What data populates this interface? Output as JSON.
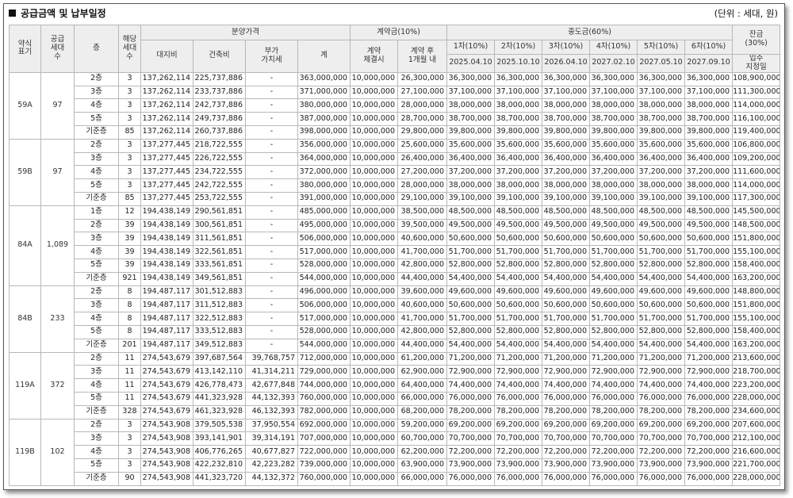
{
  "header": {
    "title": "공급금액 및 납부일정",
    "unit": "(단위 : 세대, 원)"
  },
  "columns": {
    "type": "약식\n표기",
    "households": "공급\n세대\n수",
    "floor": "층",
    "count": "해당\n세대\n수",
    "price_group": "분양가격",
    "land": "대지비",
    "building": "건축비",
    "vat": "부가\n가치세",
    "total": "계",
    "deposit_group": "계약금(10%)",
    "dep1": "계약\n체결시",
    "dep2": "계약 후\n1개월 내",
    "mid_group": "중도금(60%)",
    "mids": [
      {
        "label": "1차(10%)",
        "date": "2025.04.10"
      },
      {
        "label": "2차(10%)",
        "date": "2025.10.10"
      },
      {
        "label": "3차(10%)",
        "date": "2026.04.10"
      },
      {
        "label": "4차(10%)",
        "date": "2027.02.10"
      },
      {
        "label": "5차(10%)",
        "date": "2027.05.10"
      },
      {
        "label": "6차(10%)",
        "date": "2027.09.10"
      }
    ],
    "balance": "잔금\n(30%)",
    "balance_date": "입주\n지정일"
  },
  "groups": [
    {
      "type": "59A",
      "households": "97",
      "rows": [
        [
          "2층",
          "3",
          "137,262,114",
          "225,737,886",
          "-",
          "363,000,000",
          "10,000,000",
          "26,300,000",
          "36,300,000",
          "36,300,000",
          "36,300,000",
          "36,300,000",
          "36,300,000",
          "36,300,000",
          "108,900,000"
        ],
        [
          "3층",
          "3",
          "137,262,114",
          "233,737,886",
          "-",
          "371,000,000",
          "10,000,000",
          "27,100,000",
          "37,100,000",
          "37,100,000",
          "37,100,000",
          "37,100,000",
          "37,100,000",
          "37,100,000",
          "111,300,000"
        ],
        [
          "4층",
          "3",
          "137,262,114",
          "242,737,886",
          "-",
          "380,000,000",
          "10,000,000",
          "28,000,000",
          "38,000,000",
          "38,000,000",
          "38,000,000",
          "38,000,000",
          "38,000,000",
          "38,000,000",
          "114,000,000"
        ],
        [
          "5층",
          "3",
          "137,262,114",
          "249,737,886",
          "-",
          "387,000,000",
          "10,000,000",
          "28,700,000",
          "38,700,000",
          "38,700,000",
          "38,700,000",
          "38,700,000",
          "38,700,000",
          "38,700,000",
          "116,100,000"
        ],
        [
          "기준층",
          "85",
          "137,262,114",
          "260,737,886",
          "-",
          "398,000,000",
          "10,000,000",
          "29,800,000",
          "39,800,000",
          "39,800,000",
          "39,800,000",
          "39,800,000",
          "39,800,000",
          "39,800,000",
          "119,400,000"
        ]
      ]
    },
    {
      "type": "59B",
      "households": "97",
      "rows": [
        [
          "2층",
          "3",
          "137,277,445",
          "218,722,555",
          "-",
          "356,000,000",
          "10,000,000",
          "25,600,000",
          "35,600,000",
          "35,600,000",
          "35,600,000",
          "35,600,000",
          "35,600,000",
          "35,600,000",
          "106,800,000"
        ],
        [
          "3층",
          "3",
          "137,277,445",
          "226,722,555",
          "-",
          "364,000,000",
          "10,000,000",
          "26,400,000",
          "36,400,000",
          "36,400,000",
          "36,400,000",
          "36,400,000",
          "36,400,000",
          "36,400,000",
          "109,200,000"
        ],
        [
          "4층",
          "3",
          "137,277,445",
          "234,722,555",
          "-",
          "372,000,000",
          "10,000,000",
          "27,200,000",
          "37,200,000",
          "37,200,000",
          "37,200,000",
          "37,200,000",
          "37,200,000",
          "37,200,000",
          "111,600,000"
        ],
        [
          "5층",
          "3",
          "137,277,445",
          "242,722,555",
          "-",
          "380,000,000",
          "10,000,000",
          "28,000,000",
          "38,000,000",
          "38,000,000",
          "38,000,000",
          "38,000,000",
          "38,000,000",
          "38,000,000",
          "114,000,000"
        ],
        [
          "기준층",
          "85",
          "137,277,445",
          "253,722,555",
          "-",
          "391,000,000",
          "10,000,000",
          "29,100,000",
          "39,100,000",
          "39,100,000",
          "39,100,000",
          "39,100,000",
          "39,100,000",
          "39,100,000",
          "117,300,000"
        ]
      ]
    },
    {
      "type": "84A",
      "households": "1,089",
      "rows": [
        [
          "1층",
          "12",
          "194,438,149",
          "290,561,851",
          "-",
          "485,000,000",
          "10,000,000",
          "38,500,000",
          "48,500,000",
          "48,500,000",
          "48,500,000",
          "48,500,000",
          "48,500,000",
          "48,500,000",
          "145,500,000"
        ],
        [
          "2층",
          "39",
          "194,438,149",
          "300,561,851",
          "-",
          "495,000,000",
          "10,000,000",
          "39,500,000",
          "49,500,000",
          "49,500,000",
          "49,500,000",
          "49,500,000",
          "49,500,000",
          "49,500,000",
          "148,500,000"
        ],
        [
          "3층",
          "39",
          "194,438,149",
          "311,561,851",
          "-",
          "506,000,000",
          "10,000,000",
          "40,600,000",
          "50,600,000",
          "50,600,000",
          "50,600,000",
          "50,600,000",
          "50,600,000",
          "50,600,000",
          "151,800,000"
        ],
        [
          "4층",
          "39",
          "194,438,149",
          "322,561,851",
          "-",
          "517,000,000",
          "10,000,000",
          "41,700,000",
          "51,700,000",
          "51,700,000",
          "51,700,000",
          "51,700,000",
          "51,700,000",
          "51,700,000",
          "155,100,000"
        ],
        [
          "5층",
          "39",
          "194,438,149",
          "333,561,851",
          "-",
          "528,000,000",
          "10,000,000",
          "42,800,000",
          "52,800,000",
          "52,800,000",
          "52,800,000",
          "52,800,000",
          "52,800,000",
          "52,800,000",
          "158,400,000"
        ],
        [
          "기준층",
          "921",
          "194,438,149",
          "349,561,851",
          "-",
          "544,000,000",
          "10,000,000",
          "44,400,000",
          "54,400,000",
          "54,400,000",
          "54,400,000",
          "54,400,000",
          "54,400,000",
          "54,400,000",
          "163,200,000"
        ]
      ]
    },
    {
      "type": "84B",
      "households": "233",
      "rows": [
        [
          "2층",
          "8",
          "194,487,117",
          "301,512,883",
          "-",
          "496,000,000",
          "10,000,000",
          "39,600,000",
          "49,600,000",
          "49,600,000",
          "49,600,000",
          "49,600,000",
          "49,600,000",
          "49,600,000",
          "148,800,000"
        ],
        [
          "3층",
          "8",
          "194,487,117",
          "311,512,883",
          "-",
          "506,000,000",
          "10,000,000",
          "40,600,000",
          "50,600,000",
          "50,600,000",
          "50,600,000",
          "50,600,000",
          "50,600,000",
          "50,600,000",
          "151,800,000"
        ],
        [
          "4층",
          "8",
          "194,487,117",
          "322,512,883",
          "-",
          "517,000,000",
          "10,000,000",
          "41,700,000",
          "51,700,000",
          "51,700,000",
          "51,700,000",
          "51,700,000",
          "51,700,000",
          "51,700,000",
          "155,100,000"
        ],
        [
          "5층",
          "8",
          "194,487,117",
          "333,512,883",
          "-",
          "528,000,000",
          "10,000,000",
          "42,800,000",
          "52,800,000",
          "52,800,000",
          "52,800,000",
          "52,800,000",
          "52,800,000",
          "52,800,000",
          "158,400,000"
        ],
        [
          "기준층",
          "201",
          "194,487,117",
          "349,512,883",
          "-",
          "544,000,000",
          "10,000,000",
          "44,400,000",
          "54,400,000",
          "54,400,000",
          "54,400,000",
          "54,400,000",
          "54,400,000",
          "54,400,000",
          "163,200,000"
        ]
      ]
    },
    {
      "type": "119A",
      "households": "372",
      "rows": [
        [
          "2층",
          "11",
          "274,543,679",
          "397,687,564",
          "39,768,757",
          "712,000,000",
          "10,000,000",
          "61,200,000",
          "71,200,000",
          "71,200,000",
          "71,200,000",
          "71,200,000",
          "71,200,000",
          "71,200,000",
          "213,600,000"
        ],
        [
          "3층",
          "11",
          "274,543,679",
          "413,142,110",
          "41,314,211",
          "729,000,000",
          "10,000,000",
          "62,900,000",
          "72,900,000",
          "72,900,000",
          "72,900,000",
          "72,900,000",
          "72,900,000",
          "72,900,000",
          "218,700,000"
        ],
        [
          "4층",
          "11",
          "274,543,679",
          "426,778,473",
          "42,677,848",
          "744,000,000",
          "10,000,000",
          "64,400,000",
          "74,400,000",
          "74,400,000",
          "74,400,000",
          "74,400,000",
          "74,400,000",
          "74,400,000",
          "223,200,000"
        ],
        [
          "5층",
          "11",
          "274,543,679",
          "441,323,928",
          "44,132,393",
          "760,000,000",
          "10,000,000",
          "66,000,000",
          "76,000,000",
          "76,000,000",
          "76,000,000",
          "76,000,000",
          "76,000,000",
          "76,000,000",
          "228,000,000"
        ],
        [
          "기준층",
          "328",
          "274,543,679",
          "461,323,928",
          "46,132,393",
          "782,000,000",
          "10,000,000",
          "68,200,000",
          "78,200,000",
          "78,200,000",
          "78,200,000",
          "78,200,000",
          "78,200,000",
          "78,200,000",
          "234,600,000"
        ]
      ]
    },
    {
      "type": "119B",
      "households": "102",
      "rows": [
        [
          "2층",
          "3",
          "274,543,908",
          "379,505,538",
          "37,950,554",
          "692,000,000",
          "10,000,000",
          "59,200,000",
          "69,200,000",
          "69,200,000",
          "69,200,000",
          "69,200,000",
          "69,200,000",
          "69,200,000",
          "207,600,000"
        ],
        [
          "3층",
          "3",
          "274,543,908",
          "393,141,901",
          "39,314,191",
          "707,000,000",
          "10,000,000",
          "60,700,000",
          "70,700,000",
          "70,700,000",
          "70,700,000",
          "70,700,000",
          "70,700,000",
          "70,700,000",
          "212,100,000"
        ],
        [
          "4층",
          "3",
          "274,543,908",
          "406,776,265",
          "40,677,827",
          "722,000,000",
          "10,000,000",
          "62,200,000",
          "72,200,000",
          "72,200,000",
          "72,200,000",
          "72,200,000",
          "72,200,000",
          "72,200,000",
          "216,600,000"
        ],
        [
          "5층",
          "3",
          "274,543,908",
          "422,232,810",
          "42,223,282",
          "739,000,000",
          "10,000,000",
          "63,900,000",
          "73,900,000",
          "73,900,000",
          "73,900,000",
          "73,900,000",
          "73,900,000",
          "73,900,000",
          "221,700,000"
        ],
        [
          "기준층",
          "90",
          "274,543,908",
          "441,323,720",
          "44,132,372",
          "760,000,000",
          "10,000,000",
          "66,000,000",
          "76,000,000",
          "76,000,000",
          "76,000,000",
          "76,000,000",
          "76,000,000",
          "76,000,000",
          "228,000,000"
        ]
      ]
    }
  ]
}
